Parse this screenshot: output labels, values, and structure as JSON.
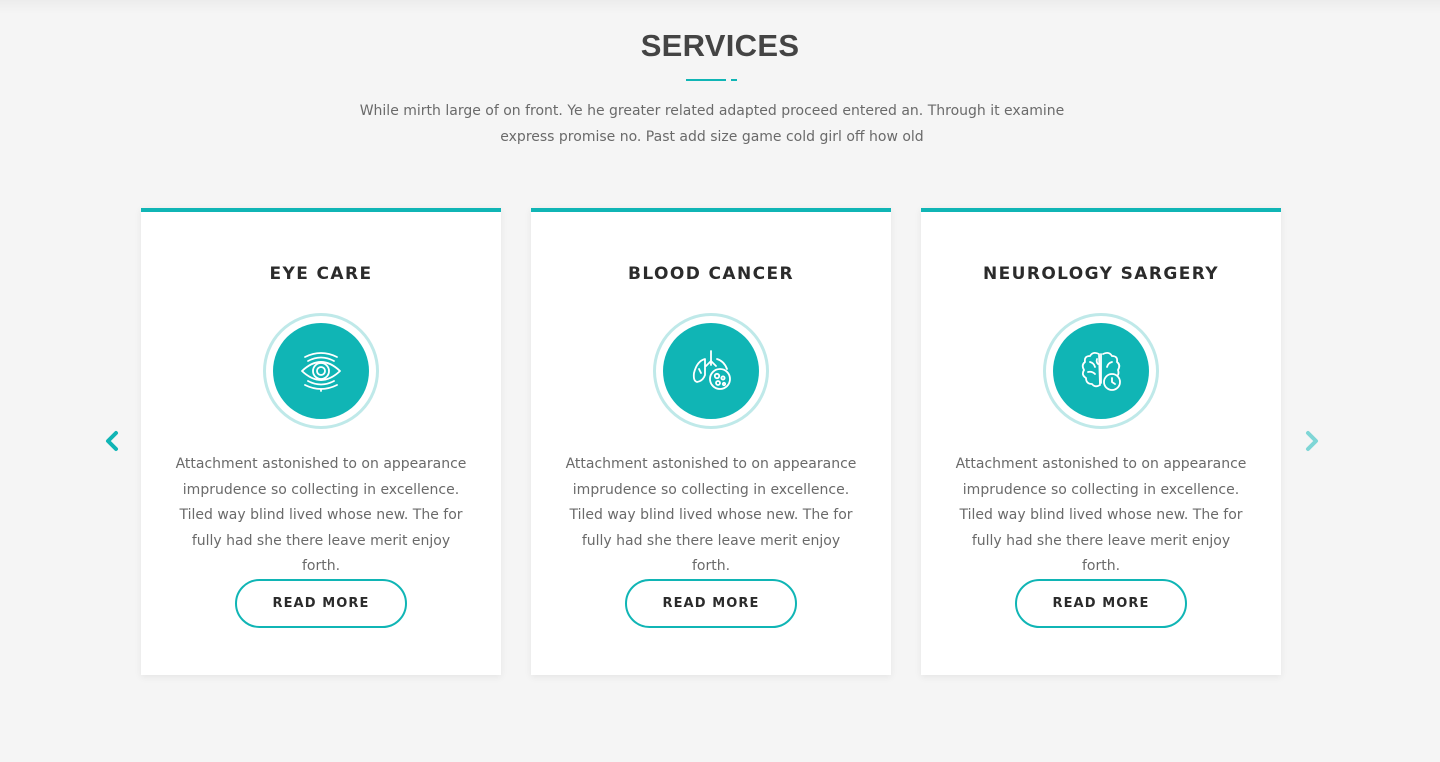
{
  "section": {
    "title": "SERVICES",
    "subtitle": "While mirth large of on front. Ye he greater related adapted proceed entered an. Through it examine express promise no. Past add size game cold girl off how old"
  },
  "colors": {
    "accent": "#10b5b5",
    "accent_light": "#bfe9e9",
    "background": "#f5f5f5",
    "card": "#ffffff",
    "heading": "#444444",
    "body_text": "#6a6a6a"
  },
  "carousel": {
    "prev_icon": "chevron-left-icon",
    "next_icon": "chevron-right-icon"
  },
  "cards": [
    {
      "title": "EYE CARE",
      "icon": "eye-icon",
      "text": "Attachment astonished to on appearance imprudence so collecting in excellence. Tiled way blind lived whose new. The for fully had she there leave merit enjoy forth.",
      "button_label": "READ MORE"
    },
    {
      "title": "BLOOD CANCER",
      "icon": "lungs-cells-icon",
      "text": "Attachment astonished to on appearance imprudence so collecting in excellence. Tiled way blind lived whose new. The for fully had she there leave merit enjoy forth.",
      "button_label": "READ MORE"
    },
    {
      "title": "NEUROLOGY SARGERY",
      "icon": "brain-clock-icon",
      "text": "Attachment astonished to on appearance imprudence so collecting in excellence. Tiled way blind lived whose new. The for fully had she there leave merit enjoy forth.",
      "button_label": "READ MORE"
    }
  ]
}
